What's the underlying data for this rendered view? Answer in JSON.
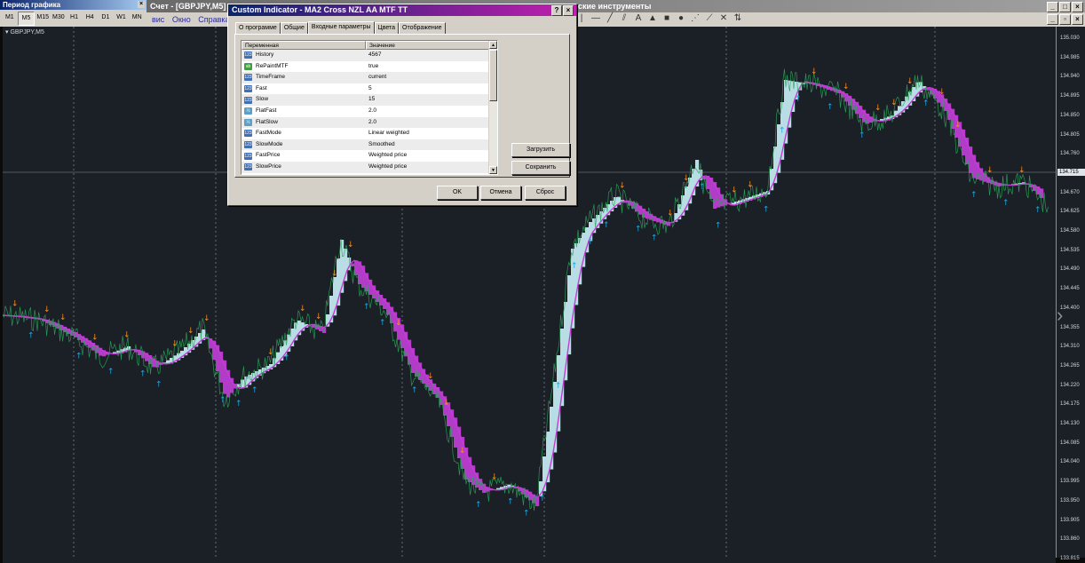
{
  "window": {
    "account_title": "Счет - [GBPJPY,M5]",
    "toolbar_title": "ские инструменты",
    "menu": [
      "вис",
      "Окно",
      "Справка"
    ]
  },
  "period_toolbar": {
    "title": "Период графика",
    "periods": [
      "M1",
      "M5",
      "M15",
      "M30",
      "H1",
      "H4",
      "D1",
      "W1",
      "MN"
    ],
    "active": "M5"
  },
  "chart": {
    "symbol_label": "GBPJPY,M5",
    "current_price": "134.715",
    "price_ticks": [
      "135.030",
      "134.985",
      "134.940",
      "134.895",
      "134.850",
      "134.805",
      "134.760",
      "134.715",
      "134.670",
      "134.625",
      "134.580",
      "134.535",
      "134.490",
      "134.445",
      "134.400",
      "134.355",
      "134.310",
      "134.265",
      "134.220",
      "134.175",
      "134.130",
      "134.085",
      "134.040",
      "133.995",
      "133.950",
      "133.905",
      "133.860",
      "133.815"
    ],
    "colors": {
      "background": "#1b2026",
      "bull_fill": "#b8dde4",
      "bear_fill": "#b23cc8",
      "up_arrow": "#1aa6e6",
      "down_arrow": "#ff8c1a",
      "price_line": "#2aa35a"
    }
  },
  "dialog": {
    "title": "Custom Indicator - MA2 Cross NZL AA MTF TT",
    "tabs": [
      "О программе",
      "Общие",
      "Входные параметры",
      "Цвета",
      "Отображение"
    ],
    "active_tab": "Входные параметры",
    "columns": {
      "variable": "Переменная",
      "value": "Значение"
    },
    "params": [
      {
        "name": "History",
        "value": "4567",
        "icon": "num"
      },
      {
        "name": "RePaintMTF",
        "value": "true",
        "icon": "bool"
      },
      {
        "name": "TimeFrame",
        "value": "current",
        "icon": "enum"
      },
      {
        "name": "Fast",
        "value": "5",
        "icon": "num"
      },
      {
        "name": "Slow",
        "value": "15",
        "icon": "num"
      },
      {
        "name": "FlatFast",
        "value": "2.0",
        "icon": "dbl"
      },
      {
        "name": "FlatSlow",
        "value": "2.0",
        "icon": "dbl"
      },
      {
        "name": "FastMode",
        "value": "Linear weighted",
        "icon": "enum"
      },
      {
        "name": "SlowMode",
        "value": "Smoothed",
        "icon": "enum"
      },
      {
        "name": "FastPrice",
        "value": "Weighted price",
        "icon": "enum"
      },
      {
        "name": "SlowPrice",
        "value": "Weighted price",
        "icon": "enum"
      }
    ],
    "load_label": "Загрузить",
    "save_label": "Сохранить",
    "ok_label": "OK",
    "cancel_label": "Отмена",
    "reset_label": "Сброс"
  }
}
